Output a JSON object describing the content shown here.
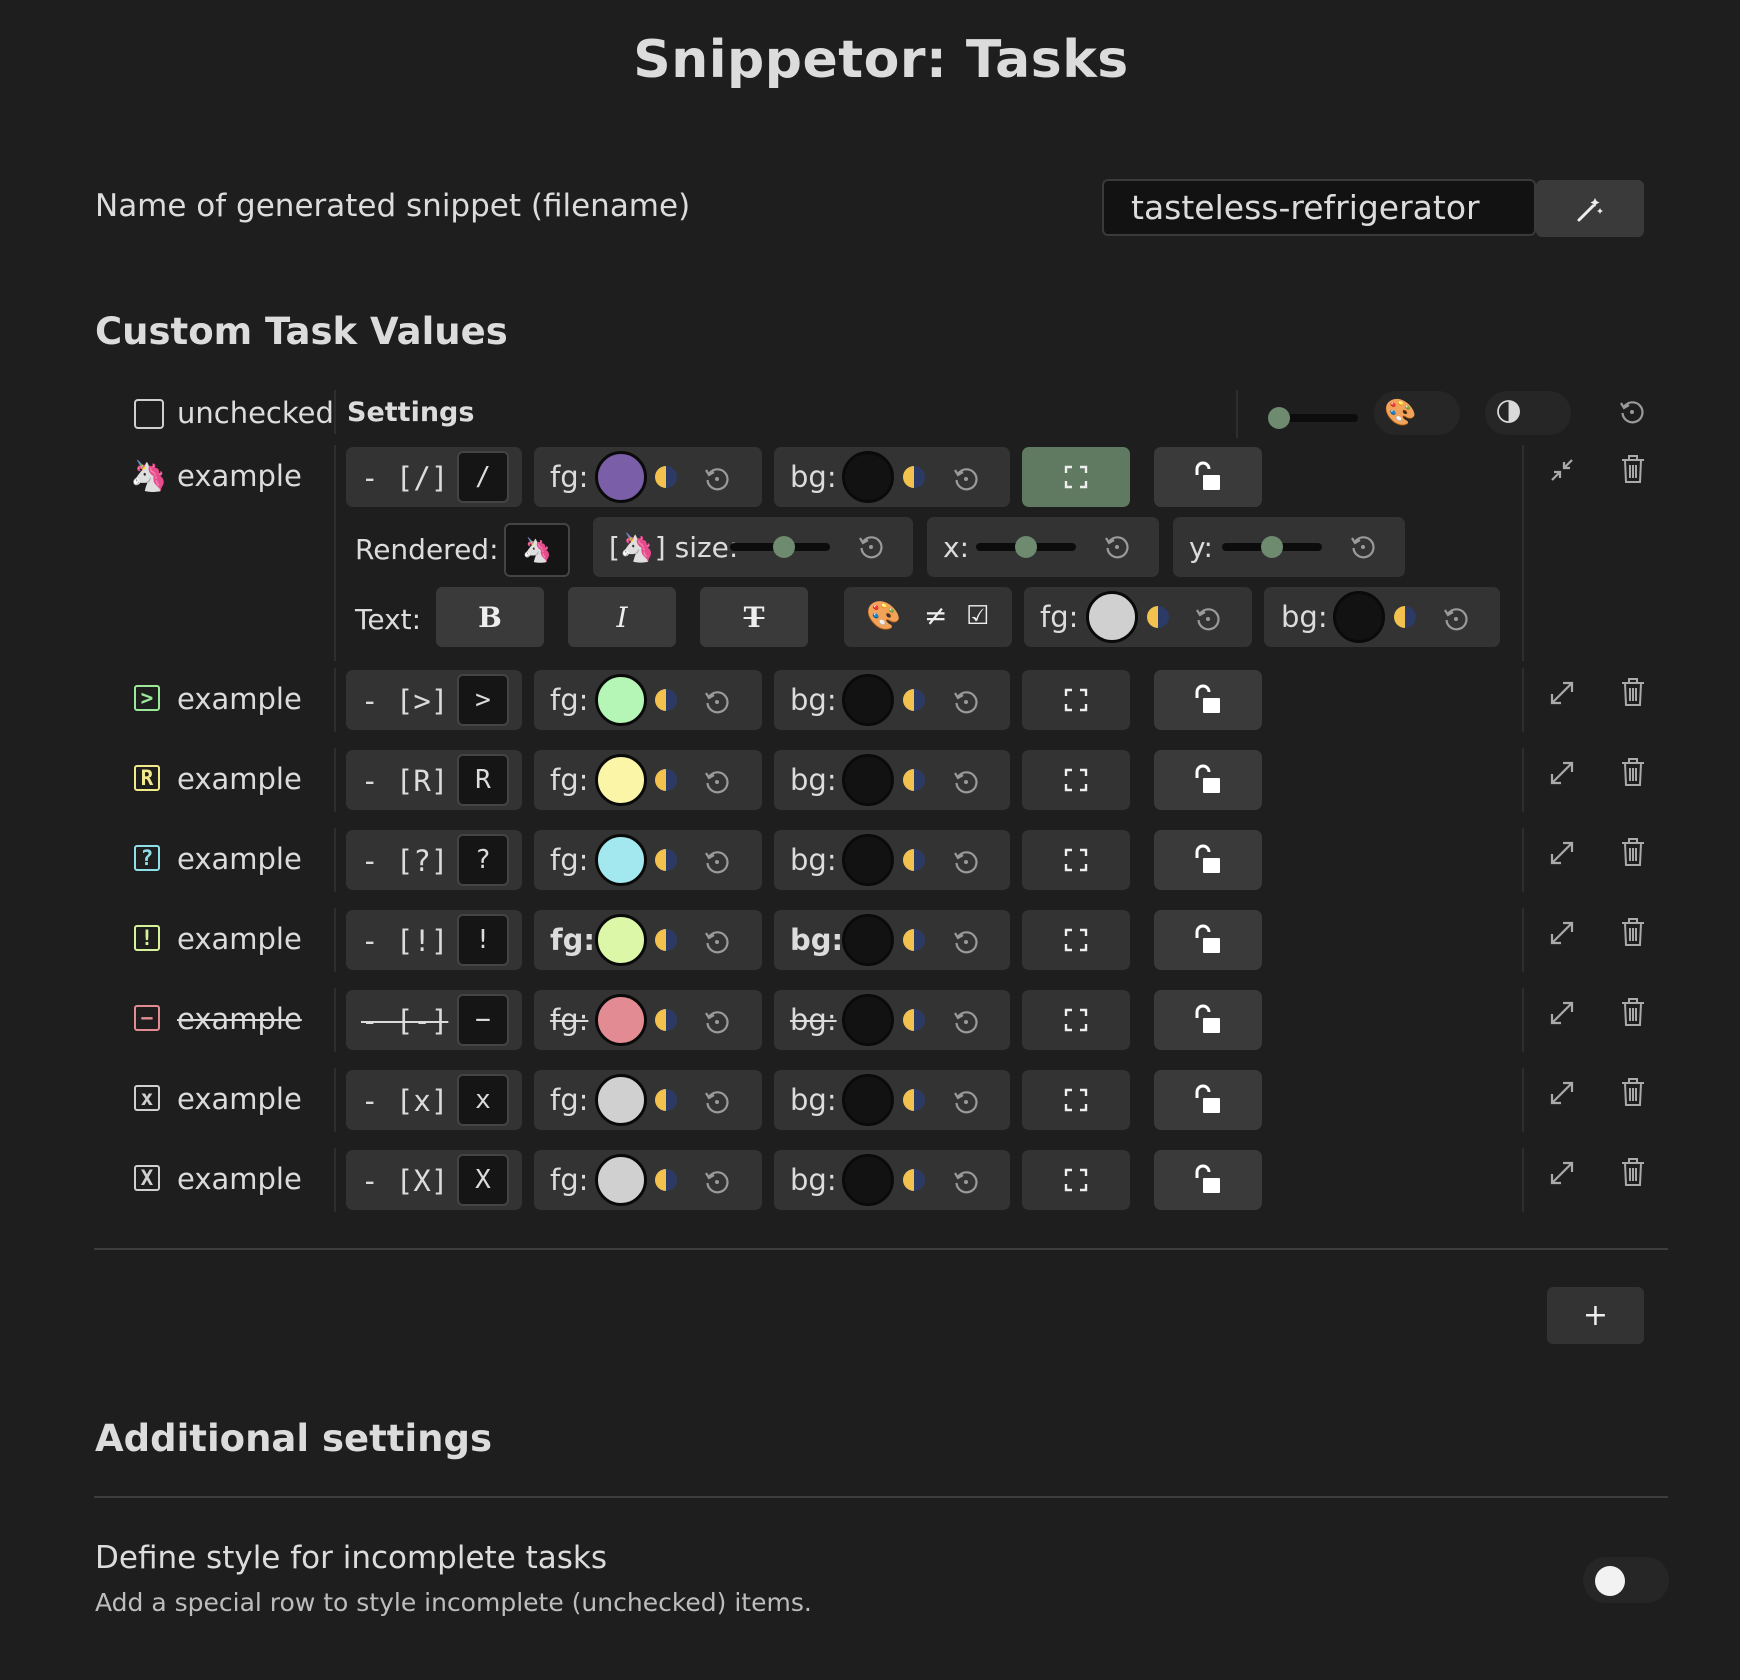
{
  "page_title": "Snippetor: Tasks",
  "snippet_name": {
    "label": "Name of generated snippet (filename)",
    "value": "tasteless-refrigerator",
    "generate_button_icon": "magic-wand-icon"
  },
  "custom_task_values": {
    "heading": "Custom Task Values",
    "unchecked_label": "unchecked",
    "settings_label": "Settings",
    "header_controls": {
      "slider_level": 0.1,
      "palette_icon": "🎨",
      "theme_icon": "🌗",
      "reset_icon": "reset-icon"
    },
    "expanded": {
      "rendered_label": "Rendered:",
      "rendered_emoji": "🦄",
      "size_label": "[🦄] size:",
      "x_label": "x:",
      "y_label": "y:",
      "text_label": "Text:",
      "bold": "B",
      "italic": "I",
      "strike": "T",
      "palette_neq": "≠",
      "checkbox_glyph": "☑",
      "fg_label": "fg:",
      "bg_label": "bg:",
      "size_level": 0.55,
      "x_level": 0.5,
      "y_level": 0.5,
      "text_fg": "#d0d0d0",
      "text_bg": "#121212"
    },
    "fg_label": "fg:",
    "bg_label": "bg:",
    "tasks": [
      {
        "icon": "🦄",
        "label": "example",
        "markdown": "- [/]",
        "char": "/",
        "fg": "#7a5fa8",
        "bg": "#121212",
        "fullscreen_active": true,
        "expanded": true
      },
      {
        "icon": ">",
        "label": "example",
        "markdown": "- [>]",
        "char": ">",
        "fg": "#b5f5b5",
        "bg": "#121212",
        "box_color": "#9be89b"
      },
      {
        "icon": "R",
        "label": "example",
        "markdown": "- [R]",
        "char": "R",
        "fg": "#fbf5a8",
        "bg": "#121212",
        "box_color": "#f2e98a"
      },
      {
        "icon": "?",
        "label": "example",
        "markdown": "- [?]",
        "char": "?",
        "fg": "#a3e8ef",
        "bg": "#121212",
        "box_color": "#8fdfe9"
      },
      {
        "icon": "!",
        "label": "example",
        "markdown": "- [!]",
        "char": "!",
        "fg": "#dcf7a8",
        "bg": "#121212",
        "box_color": "#d7f29b",
        "bold": true
      },
      {
        "icon": "−",
        "label": "example",
        "markdown": "- [-]",
        "char": "−",
        "fg": "#e28b92",
        "bg": "#121212",
        "box_color": "#e28b92",
        "strike": true
      },
      {
        "icon": "x",
        "label": "example",
        "markdown": "- [x]",
        "char": "x",
        "fg": "#d0d0d0",
        "bg": "#121212",
        "box_color": "#d0d0d0"
      },
      {
        "icon": "X",
        "label": "example",
        "markdown": "- [X]",
        "char": "X",
        "fg": "#d0d0d0",
        "bg": "#121212",
        "box_color": "#d0d0d0"
      }
    ],
    "add_button": "+"
  },
  "additional_settings": {
    "heading": "Additional settings",
    "incomplete_title": "Define style for incomplete tasks",
    "incomplete_desc": "Add a special row to style incomplete (unchecked) items.",
    "toggle_on": false
  }
}
